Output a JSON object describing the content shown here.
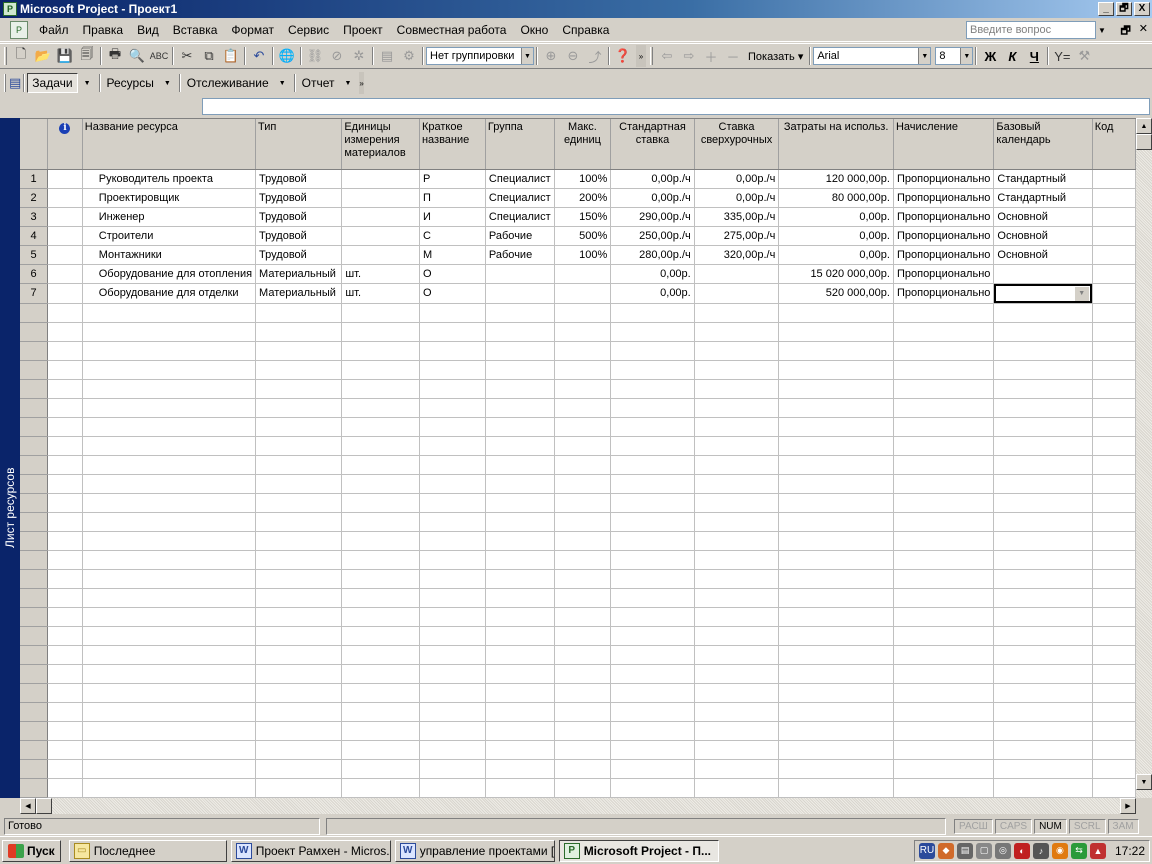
{
  "window": {
    "title": "Microsoft Project - Проект1",
    "minimize": "_",
    "restore": "🗗",
    "close": "X"
  },
  "menu": {
    "items": [
      "Файл",
      "Правка",
      "Вид",
      "Вставка",
      "Формат",
      "Сервис",
      "Проект",
      "Совместная работа",
      "Окно",
      "Справка"
    ],
    "ask_placeholder": "Введите вопрос"
  },
  "toolbar": {
    "grouping": "Нет группировки",
    "show_label": "Показать",
    "font_name": "Arial",
    "font_size": "8",
    "bold": "Ж",
    "italic": "К",
    "underline": "Ч"
  },
  "toolbar2": {
    "tasks": "Задачи",
    "resources": "Ресурсы",
    "tracking": "Отслеживание",
    "report": "Отчет"
  },
  "viewbar": {
    "label": "Лист ресурсов"
  },
  "sheet": {
    "headers": [
      "",
      "Название ресурса",
      "Тип",
      "Единицы измерения материалов",
      "Краткое название",
      "Группа",
      "Макс. единиц",
      "Стандартная ставка",
      "Ставка сверхурочных",
      "Затраты на использ.",
      "Начисление",
      "Базовый календарь",
      "Код"
    ],
    "rows": [
      {
        "id": "1",
        "name": "Руководитель проекта",
        "type": "Трудовой",
        "units": "",
        "short": "Р",
        "group": "Специалист",
        "max": "100%",
        "std": "0,00р./ч",
        "ovt": "0,00р./ч",
        "cost": "120 000,00р.",
        "accrue": "Пропорционально",
        "calendar": "Стандартный",
        "code": ""
      },
      {
        "id": "2",
        "name": "Проектировщик",
        "type": "Трудовой",
        "units": "",
        "short": "П",
        "group": "Специалист",
        "max": "200%",
        "std": "0,00р./ч",
        "ovt": "0,00р./ч",
        "cost": "80 000,00р.",
        "accrue": "Пропорционально",
        "calendar": "Стандартный",
        "code": ""
      },
      {
        "id": "3",
        "name": "Инженер",
        "type": "Трудовой",
        "units": "",
        "short": "И",
        "group": "Специалист",
        "max": "150%",
        "std": "290,00р./ч",
        "ovt": "335,00р./ч",
        "cost": "0,00р.",
        "accrue": "Пропорционально",
        "calendar": "Основной",
        "code": ""
      },
      {
        "id": "4",
        "name": "Строители",
        "type": "Трудовой",
        "units": "",
        "short": "С",
        "group": "Рабочие",
        "max": "500%",
        "std": "250,00р./ч",
        "ovt": "275,00р./ч",
        "cost": "0,00р.",
        "accrue": "Пропорционально",
        "calendar": "Основной",
        "code": ""
      },
      {
        "id": "5",
        "name": "Монтажники",
        "type": "Трудовой",
        "units": "",
        "short": "М",
        "group": "Рабочие",
        "max": "100%",
        "std": "280,00р./ч",
        "ovt": "320,00р./ч",
        "cost": "0,00р.",
        "accrue": "Пропорционально",
        "calendar": "Основной",
        "code": ""
      },
      {
        "id": "6",
        "name": "Оборудование для отопления",
        "type": "Материальный",
        "units": "шт.",
        "short": "О",
        "group": "",
        "max": "",
        "std": "0,00р.",
        "ovt": "",
        "cost": "15 020 000,00р.",
        "accrue": "Пропорционально",
        "calendar": "",
        "code": ""
      },
      {
        "id": "7",
        "name": "Оборудование для отделки",
        "type": "Материальный",
        "units": "шт.",
        "short": "О",
        "group": "",
        "max": "",
        "std": "0,00р.",
        "ovt": "",
        "cost": "520 000,00р.",
        "accrue": "Пропорционально",
        "calendar": "",
        "code": ""
      }
    ]
  },
  "status": {
    "ready": "Готово",
    "indicators": [
      "РАСШ",
      "CAPS",
      "NUM",
      "SCRL",
      "ЗАМ"
    ],
    "active_indicator": "NUM"
  },
  "taskbar": {
    "start": "Пуск",
    "buttons": [
      "Последнее",
      "Проект Рамхен - Micros...",
      "управление проектами [...",
      "Microsoft Project - П..."
    ],
    "lang": "RU",
    "clock": "17:22"
  }
}
